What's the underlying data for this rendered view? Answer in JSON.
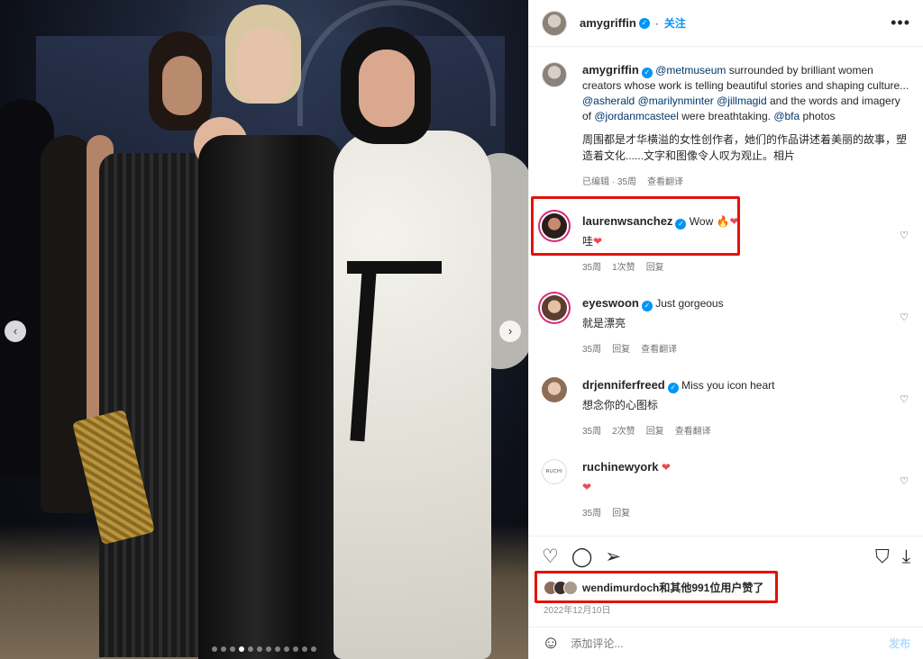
{
  "post": {
    "author": "amygriffin",
    "follow_label": "关注",
    "more_icon": "more-horizontal-icon"
  },
  "caption": {
    "username": "amygriffin",
    "mention_met": "@metmuseum",
    "text_1": " surrounded by brilliant women creators whose work is telling beautiful stories and shaping culture... ",
    "mention_1": "@asherald",
    "mention_2": "@marilynminter",
    "mention_3": "@jillmagid",
    "text_2": " and the words and imagery of ",
    "mention_4": "@jordanmcasteel",
    "text_3": " were breathtaking. ",
    "mention_5": "@bfa",
    "text_4": " photos",
    "translation": "周围都是才华横溢的女性创作者，她们的作品讲述着美丽的故事，塑造着文化......文字和图像令人叹为观止。相片",
    "meta": [
      "已编辑 · 35周",
      "查看翻译"
    ]
  },
  "comments": [
    {
      "username": "laurenwsanchez",
      "text": "Wow ",
      "emoji": "🔥",
      "heart": "❤",
      "translation": "哇",
      "translation_heart": "❤",
      "meta": [
        "35周",
        "1次赞",
        "回复"
      ]
    },
    {
      "username": "eyeswoon",
      "text": "Just gorgeous",
      "translation": "就是漂亮",
      "meta": [
        "35周",
        "回复",
        "查看翻译"
      ]
    },
    {
      "username": "drjenniferfreed",
      "text": "Miss you icon heart",
      "translation": "想念你的心图标",
      "meta": [
        "35周",
        "2次赞",
        "回复",
        "查看翻译"
      ]
    },
    {
      "username": "ruchinewyork",
      "heart": "❤",
      "body_heart": "❤",
      "meta": [
        "35周",
        "回复"
      ],
      "avatar_text": "RUCHI"
    }
  ],
  "likes": {
    "text": "wendimurdoch和其他991位用户赞了"
  },
  "date": "2022年12月10日",
  "comment_box": {
    "placeholder": "添加评论...",
    "post_label": "发布"
  },
  "carousel": {
    "total": 12,
    "active": 3
  },
  "colors": {
    "accent": "#0095f6",
    "highlight": "#e3120b",
    "like_red": "#ed4956"
  }
}
